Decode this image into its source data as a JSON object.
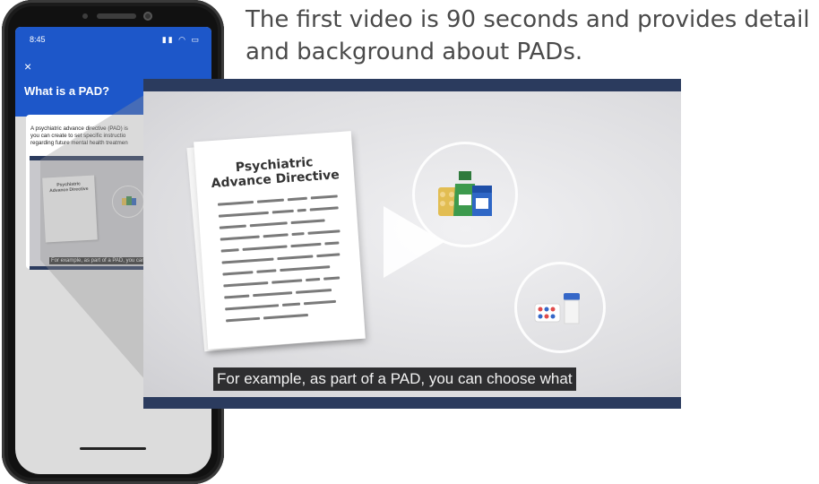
{
  "caption": {
    "line1": "The first video is 90 seconds and provides detail",
    "line2": "and background about PADs."
  },
  "phone": {
    "status_time": "8:45",
    "status_icons": "▮▮ ◠ ▭",
    "close_label": "×",
    "title": "What is a PAD?",
    "card_text": "A psychiatric advance directive (PAD) is\nyou can create to set specific instructio\nregarding future mental health treatmen",
    "mini_doc_title": "Psychiatric\nAdvance Directive",
    "mini_caption": "For example, as part of a PAD, you can"
  },
  "video": {
    "doc_title": "Psychiatric\nAdvance Directive",
    "caption": "For example, as part of a PAD, you can choose what"
  },
  "colors": {
    "appbar": "#1d57c9",
    "video_bars": "#2b3b5e",
    "caption_bg": "#2e2e30"
  },
  "icons": [
    "play-icon",
    "medicine-bottles-icon",
    "pills-icon"
  ]
}
